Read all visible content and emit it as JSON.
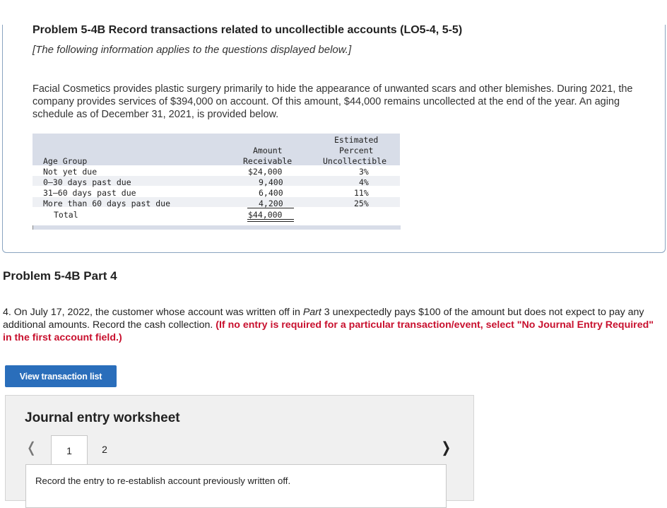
{
  "header": {
    "title": "Problem 5-4B Record transactions related to uncollectible accounts (LO5-4, 5-5)",
    "subtitle": "[The following information applies to the questions displayed below.]"
  },
  "intro": "Facial Cosmetics provides plastic surgery primarily to hide the appearance of unwanted scars and other blemishes. During 2021, the company provides services of $394,000 on account. Of this amount, $44,000 remains uncollected at the end of the year. An aging schedule as of December 31, 2021, is provided below.",
  "aging": {
    "col_amount_1": "Amount",
    "col_amount_2": "Receivable",
    "col_pct_1": "Estimated",
    "col_pct_2": "Percent",
    "col_pct_3": "Uncollectible",
    "col_group": "Age Group",
    "rows": [
      {
        "group": "Not yet due",
        "amount": "$24,000",
        "pct": "3%"
      },
      {
        "group": "0–30 days past due",
        "amount": "9,400",
        "pct": "4%"
      },
      {
        "group": "31–60 days past due",
        "amount": "6,400",
        "pct": "11%"
      },
      {
        "group": "More than 60 days past due",
        "amount": "4,200",
        "pct": "25%"
      }
    ],
    "total_label": "Total",
    "total_amount": "$44,000"
  },
  "part": {
    "title": "Problem 5-4B Part 4",
    "question_main": "4. On July 17, 2022, the customer whose account was written off in ",
    "question_italic": "Part",
    "question_rest": " 3 unexpectedly pays $100 of the amount but does not expect to pay any additional amounts. Record the cash collection. ",
    "question_red": "(If no entry is required for a particular transaction/event, select \"No Journal Entry Required\" in the first account field.)"
  },
  "buttons": {
    "view_list": "View transaction list"
  },
  "worksheet": {
    "title": "Journal entry worksheet",
    "tabs": [
      "1",
      "2"
    ],
    "instruction": "Record the entry to re-establish account previously written off."
  }
}
